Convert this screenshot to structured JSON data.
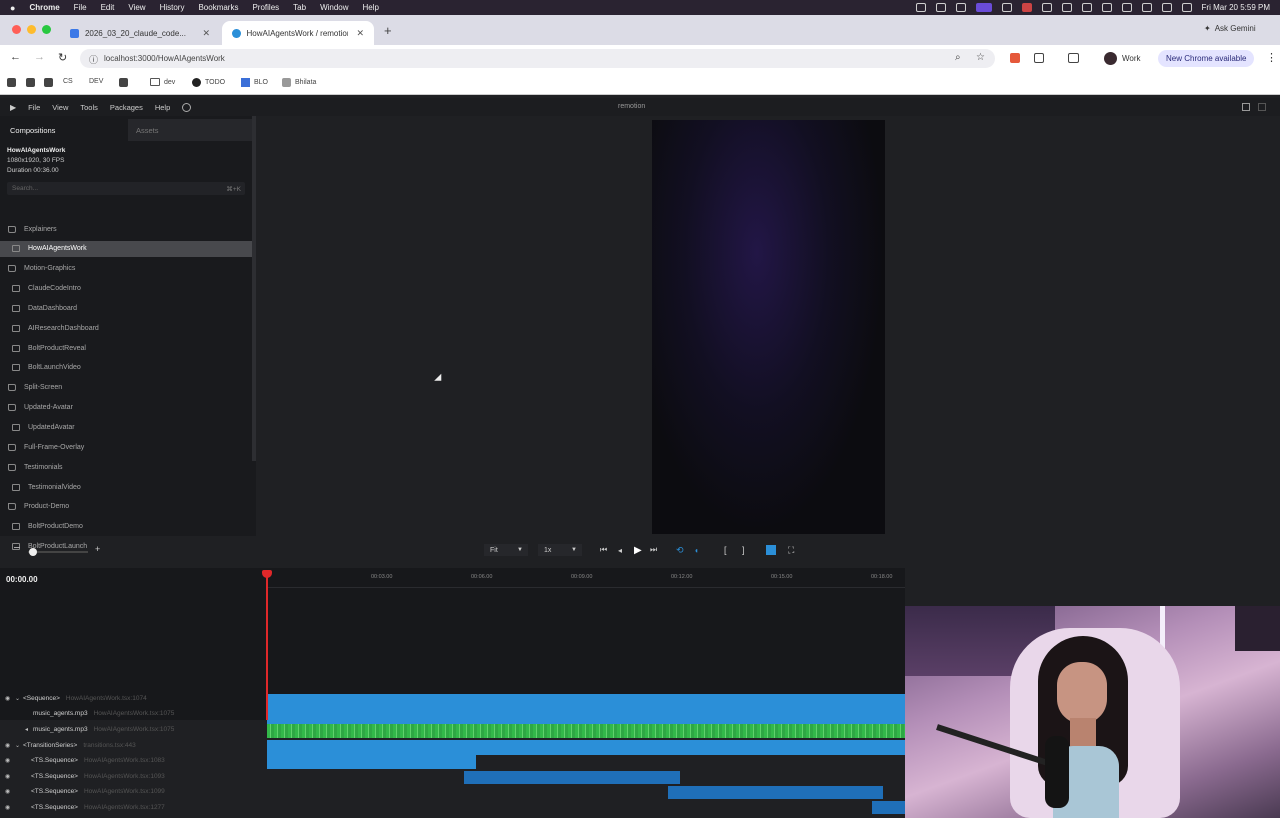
{
  "menubar": {
    "app": "Chrome",
    "items": [
      "File",
      "Edit",
      "View",
      "History",
      "Bookmarks",
      "Profiles",
      "Tab",
      "Window",
      "Help"
    ],
    "datetime": "Fri Mar 20  5:59 PM"
  },
  "tabs": [
    {
      "label": "2026_03_20_claude_code...",
      "active": false
    },
    {
      "label": "HowAIAgentsWork / remotion",
      "active": true
    }
  ],
  "ask_gemini": "Ask Gemini",
  "url": "localhost:3000/HowAIAgentsWork",
  "profile": "Work",
  "chrome_update": "New Chrome available",
  "bookmarks": [
    "CS",
    "DEV",
    "dev",
    "TODO",
    "BLO",
    "Bhilata"
  ],
  "app": {
    "menu": [
      "File",
      "View",
      "Tools",
      "Packages",
      "Help"
    ],
    "window_title": "remotion",
    "sidebar_tabs": {
      "compositions": "Compositions",
      "assets": "Assets"
    },
    "comp_info": {
      "name": "HowAIAgentsWork",
      "specs": "1080x1920, 30 FPS",
      "duration": "Duration 00:36.00"
    },
    "search_placeholder": "Search...",
    "search_shortcut": "⌘+K",
    "compositions": [
      {
        "label": "Explainers",
        "type": "folder",
        "selected": false
      },
      {
        "label": "HowAIAgentsWork",
        "type": "comp",
        "selected": true
      },
      {
        "label": "Motion-Graphics",
        "type": "folder",
        "selected": false
      },
      {
        "label": "ClaudeCodeIntro",
        "type": "comp",
        "selected": false
      },
      {
        "label": "DataDashboard",
        "type": "comp",
        "selected": false
      },
      {
        "label": "AIResearchDashboard",
        "type": "comp",
        "selected": false
      },
      {
        "label": "BoltProductReveal",
        "type": "comp",
        "selected": false
      },
      {
        "label": "BoltLaunchVideo",
        "type": "comp",
        "selected": false
      },
      {
        "label": "Split-Screen",
        "type": "folder",
        "selected": false
      },
      {
        "label": "Updated-Avatar",
        "type": "folder",
        "selected": false
      },
      {
        "label": "UpdatedAvatar",
        "type": "comp",
        "selected": false
      },
      {
        "label": "Full-Frame-Overlay",
        "type": "folder",
        "selected": false
      },
      {
        "label": "Testimonials",
        "type": "folder",
        "selected": false
      },
      {
        "label": "TestimonialVideo",
        "type": "comp",
        "selected": false
      },
      {
        "label": "Product-Demo",
        "type": "folder",
        "selected": false
      },
      {
        "label": "BoltProductDemo",
        "type": "comp",
        "selected": false
      },
      {
        "label": "BoltProductLaunch",
        "type": "comp",
        "selected": false
      }
    ],
    "zoom_select": "Fit",
    "speed_select": "1x",
    "timecode": "00:00.00",
    "ruler_ticks": [
      "00:03.00",
      "00:06.00",
      "00:09.00",
      "00:12.00",
      "00:15.00",
      "00:18.00"
    ],
    "tracks": [
      {
        "label": "<Sequence>",
        "sub": "HowAIAgentsWork.tsx:1074"
      },
      {
        "label": "music_agents.mp3",
        "sub": "HowAIAgentsWork.tsx:1075"
      },
      {
        "label": "music_agents.mp3",
        "sub": "HowAIAgentsWork.tsx:1075"
      },
      {
        "label": "<TransitionSeries>",
        "sub": "transitions.tsx:443"
      },
      {
        "label": "<TS.Sequence>",
        "sub": "HowAIAgentsWork.tsx:1083"
      },
      {
        "label": "<TS.Sequence>",
        "sub": "HowAIAgentsWork.tsx:1093"
      },
      {
        "label": "<TS.Sequence>",
        "sub": "HowAIAgentsWork.tsx:1099"
      },
      {
        "label": "<TS.Sequence>",
        "sub": "HowAIAgentsWork.tsx:1277"
      }
    ]
  },
  "colors": {
    "accent": "#2b8fd8",
    "playhead": "#e0282a",
    "audio": "#33b84a",
    "preview": "#120f22"
  }
}
